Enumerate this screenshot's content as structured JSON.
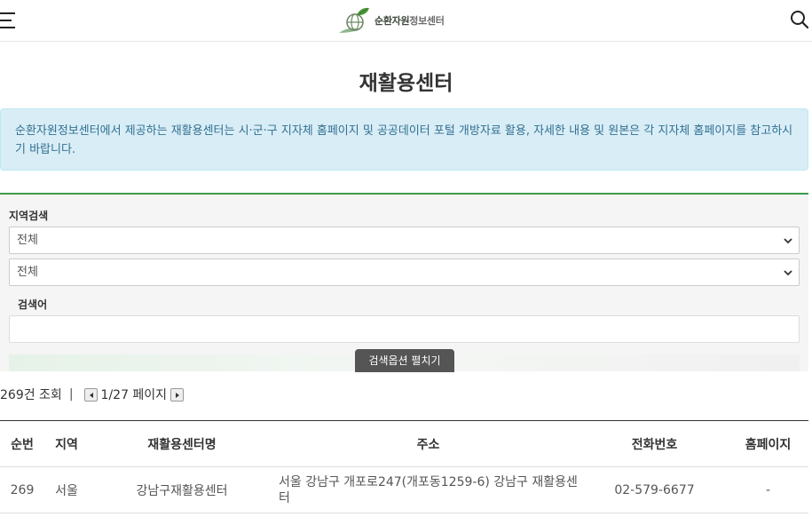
{
  "header": {
    "logo_text_bold": "순환자원",
    "logo_text_light": "정보센터"
  },
  "page": {
    "title": "재활용센터"
  },
  "info": {
    "text": "순환자원정보센터에서 제공하는 재활용센터는 시·군·구 지자체 홈페이지 및 공공데이터 포털 개방자료 활용, 자세한 내용 및 원본은 각 지자체 홈페이지를 참고하시기 바랍니다."
  },
  "search": {
    "region_label": "지역검색",
    "region1_selected": "전체",
    "region2_selected": "전체",
    "keyword_label": "검색어",
    "keyword_value": "",
    "expand_label": "검색옵션 펼치기"
  },
  "results": {
    "count_text": "269건 조회",
    "separator": "|",
    "page_text": "1/27 페이지"
  },
  "table": {
    "headers": [
      "순번",
      "지역",
      "재활용센터명",
      "주소",
      "전화번호",
      "홈페이지"
    ],
    "rows": [
      {
        "num": "269",
        "region": "서울",
        "name": "강남구재활용센터",
        "address": "서울 강남구 개포로247(개포동1259-6) 강남구 재활용센터",
        "phone": "02-579-6677",
        "homepage": "-"
      }
    ]
  },
  "colors": {
    "accent_green": "#3d9b4a",
    "info_bg": "#d9edf7",
    "info_text": "#31708f",
    "expand_button_bg": "#555555"
  },
  "icons": {
    "menu": "hamburger-menu-icon",
    "search": "search-icon",
    "logo": "globe-leaf-logo",
    "select": "chevron-down-icon",
    "prev": "chevron-left-icon",
    "next": "chevron-right-icon"
  }
}
